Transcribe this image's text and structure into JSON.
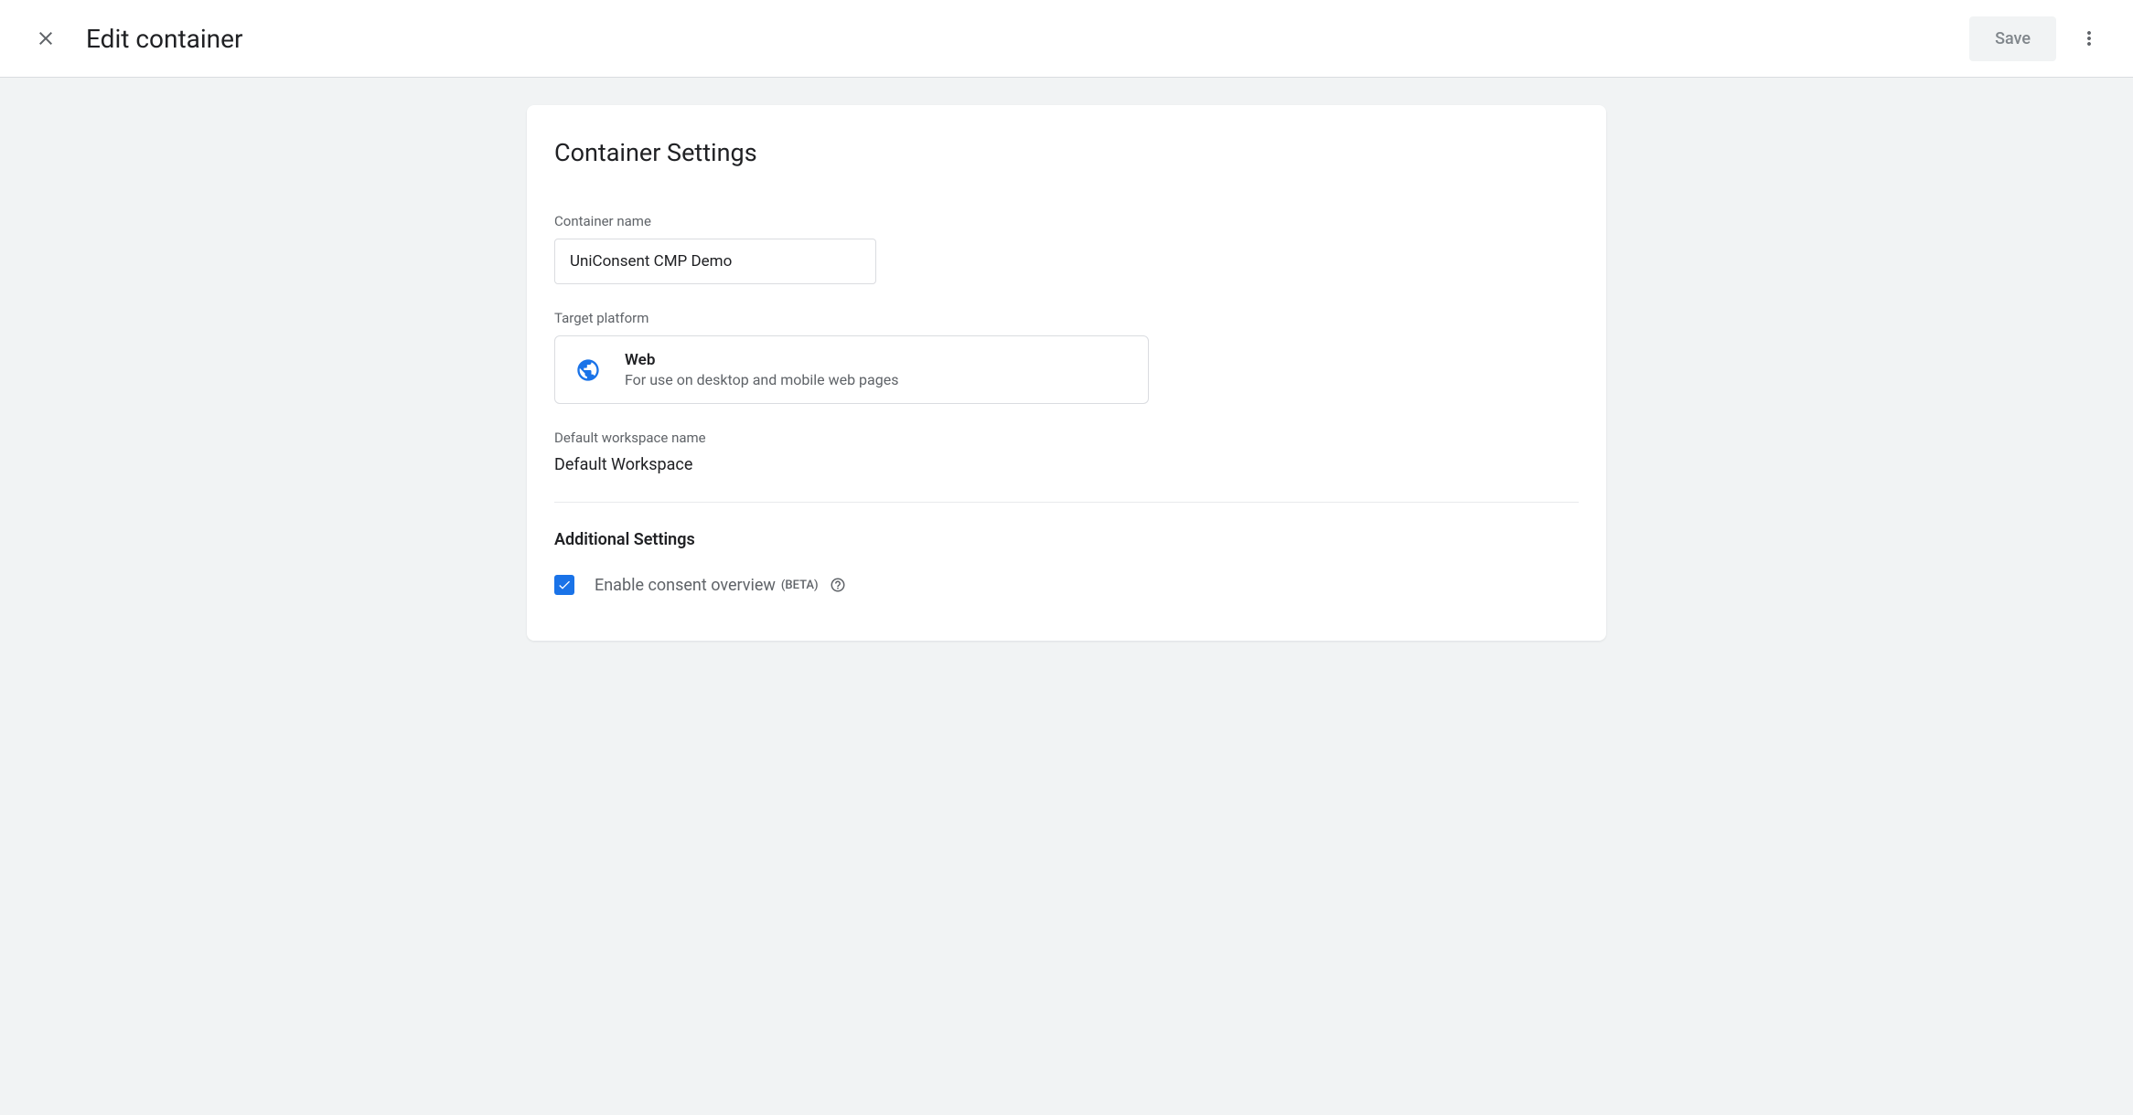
{
  "header": {
    "title": "Edit container",
    "save_label": "Save"
  },
  "card": {
    "title": "Container Settings",
    "container_name_label": "Container name",
    "container_name_value": "UniConsent CMP Demo",
    "target_platform_label": "Target platform",
    "platform": {
      "name": "Web",
      "description": "For use on desktop and mobile web pages"
    },
    "workspace_label": "Default workspace name",
    "workspace_value": "Default Workspace",
    "additional_title": "Additional Settings",
    "consent_checkbox_label": "Enable consent overview",
    "beta_label": "(BETA)"
  }
}
